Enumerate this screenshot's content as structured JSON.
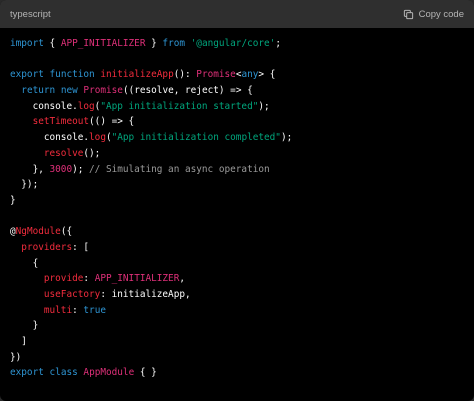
{
  "header": {
    "language": "typescript",
    "copy_label": "Copy code"
  },
  "icons": {
    "copy": "copy-icon"
  },
  "colors": {
    "background": "#000000",
    "header_background": "#2f2f2f",
    "header_text": "#b4b4b4",
    "keyword": "#2e95d3",
    "class_name": "#df3079",
    "string": "#00a67d",
    "function": "#f22c3d",
    "comment": "#9a9a9a",
    "plain": "#ffffff"
  },
  "code_lines": [
    [
      [
        "kw",
        "import"
      ],
      [
        "plain",
        " { "
      ],
      [
        "cls",
        "APP_INITIALIZER"
      ],
      [
        "plain",
        " } "
      ],
      [
        "kw",
        "from"
      ],
      [
        "plain",
        " "
      ],
      [
        "str",
        "'@angular/core'"
      ],
      [
        "plain",
        ";"
      ]
    ],
    [],
    [
      [
        "kw",
        "export"
      ],
      [
        "plain",
        " "
      ],
      [
        "kw",
        "function"
      ],
      [
        "plain",
        " "
      ],
      [
        "fn",
        "initializeApp"
      ],
      [
        "plain",
        "(): "
      ],
      [
        "cls",
        "Promise"
      ],
      [
        "plain",
        "<"
      ],
      [
        "kw",
        "any"
      ],
      [
        "plain",
        "> {"
      ]
    ],
    [
      [
        "plain",
        "  "
      ],
      [
        "kw",
        "return"
      ],
      [
        "plain",
        " "
      ],
      [
        "kw",
        "new"
      ],
      [
        "plain",
        " "
      ],
      [
        "cls",
        "Promise"
      ],
      [
        "plain",
        "((resolve, reject) => {"
      ]
    ],
    [
      [
        "plain",
        "    console."
      ],
      [
        "fn",
        "log"
      ],
      [
        "plain",
        "("
      ],
      [
        "str",
        "\"App initialization started\""
      ],
      [
        "plain",
        ");"
      ]
    ],
    [
      [
        "plain",
        "    "
      ],
      [
        "fn",
        "setTimeout"
      ],
      [
        "plain",
        "(() => {"
      ]
    ],
    [
      [
        "plain",
        "      console."
      ],
      [
        "fn",
        "log"
      ],
      [
        "plain",
        "("
      ],
      [
        "str",
        "\"App initialization completed\""
      ],
      [
        "plain",
        ");"
      ]
    ],
    [
      [
        "plain",
        "      "
      ],
      [
        "fn",
        "resolve"
      ],
      [
        "plain",
        "();"
      ]
    ],
    [
      [
        "plain",
        "    }, "
      ],
      [
        "num",
        "3000"
      ],
      [
        "plain",
        "); "
      ],
      [
        "cm",
        "// Simulating an async operation"
      ]
    ],
    [
      [
        "plain",
        "  });"
      ]
    ],
    [
      [
        "plain",
        "}"
      ]
    ],
    [],
    [
      [
        "plain",
        "@"
      ],
      [
        "fn",
        "NgModule"
      ],
      [
        "plain",
        "({"
      ]
    ],
    [
      [
        "plain",
        "  "
      ],
      [
        "fn",
        "providers"
      ],
      [
        "plain",
        ": ["
      ]
    ],
    [
      [
        "plain",
        "    {"
      ]
    ],
    [
      [
        "plain",
        "      "
      ],
      [
        "fn",
        "provide"
      ],
      [
        "plain",
        ": "
      ],
      [
        "cls",
        "APP_INITIALIZER"
      ],
      [
        "plain",
        ","
      ]
    ],
    [
      [
        "plain",
        "      "
      ],
      [
        "fn",
        "useFactory"
      ],
      [
        "plain",
        ": initializeApp,"
      ]
    ],
    [
      [
        "plain",
        "      "
      ],
      [
        "fn",
        "multi"
      ],
      [
        "plain",
        ": "
      ],
      [
        "kw",
        "true"
      ]
    ],
    [
      [
        "plain",
        "    }"
      ]
    ],
    [
      [
        "plain",
        "  ]"
      ]
    ],
    [
      [
        "plain",
        "})"
      ]
    ],
    [
      [
        "kw",
        "export"
      ],
      [
        "plain",
        " "
      ],
      [
        "kw",
        "class"
      ],
      [
        "plain",
        " "
      ],
      [
        "cls",
        "AppModule"
      ],
      [
        "plain",
        " { }"
      ]
    ]
  ]
}
